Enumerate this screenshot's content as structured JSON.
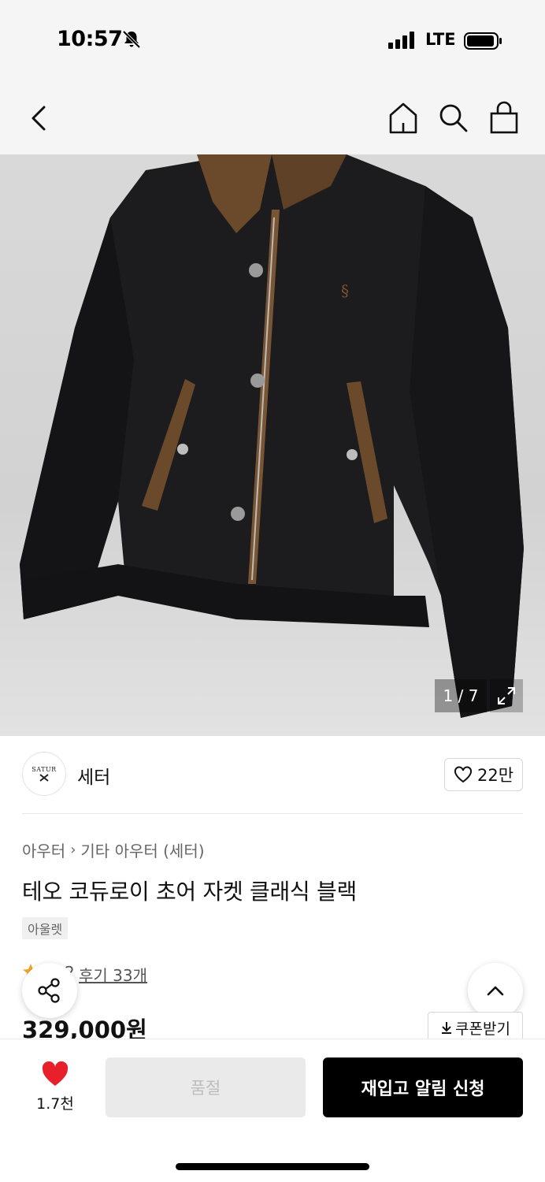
{
  "status_bar": {
    "time": "10:57",
    "network": "LTE"
  },
  "header": {
    "icons": [
      "back-icon",
      "home-icon",
      "search-icon",
      "bag-icon"
    ]
  },
  "gallery": {
    "counter": "1 / 7"
  },
  "brand": {
    "logo_text": "SATUR",
    "name": "세터",
    "like_count": "22만"
  },
  "product": {
    "breadcrumb": [
      "아우터",
      "기타 아우터 (세터)"
    ],
    "title": "테오 코듀로이 초어 자켓 클래식 블랙",
    "badge": "아울렛",
    "rating_partial": "2",
    "review_label": "후기 33개",
    "price": "329,000원",
    "coupon_label": "쿠폰받기"
  },
  "bottom_bar": {
    "wish_count": "1.7천",
    "soldout_label": "품절",
    "restock_label": "재입고 알림 신청"
  },
  "colors": {
    "accent": "#000000",
    "heart": "#e8202b",
    "star": "#f5a623"
  }
}
